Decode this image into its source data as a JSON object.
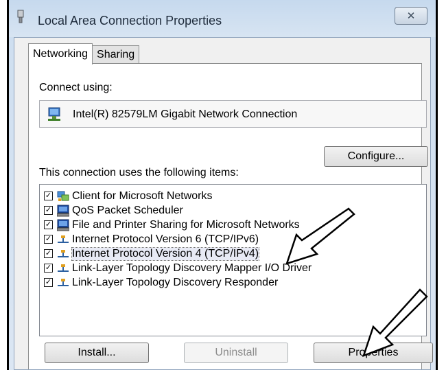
{
  "window": {
    "title": "Local Area Connection Properties",
    "close_glyph": "✕"
  },
  "tabs": [
    {
      "label": "Networking",
      "active": true
    },
    {
      "label": "Sharing",
      "active": false
    }
  ],
  "connect_using": {
    "label": "Connect using:",
    "adapter": "Intel(R) 82579LM Gigabit Network Connection",
    "configure_label": "Configure..."
  },
  "items_section": {
    "label": "This connection uses the following items:",
    "items": [
      {
        "label": "Client for Microsoft Networks",
        "checked": true,
        "icon": "network-client-icon"
      },
      {
        "label": "QoS Packet Scheduler",
        "checked": true,
        "icon": "network-service-icon"
      },
      {
        "label": "File and Printer Sharing for Microsoft Networks",
        "checked": true,
        "icon": "network-service-icon"
      },
      {
        "label": "Internet Protocol Version 6 (TCP/IPv6)",
        "checked": true,
        "icon": "network-protocol-icon"
      },
      {
        "label": "Internet Protocol Version 4 (TCP/IPv4)",
        "checked": true,
        "icon": "network-protocol-icon",
        "selected": true
      },
      {
        "label": "Link-Layer Topology Discovery Mapper I/O Driver",
        "checked": true,
        "icon": "network-protocol-icon"
      },
      {
        "label": "Link-Layer Topology Discovery Responder",
        "checked": true,
        "icon": "network-protocol-icon"
      }
    ],
    "check_glyph": "✓"
  },
  "buttons": {
    "install": "Install...",
    "uninstall": "Uninstall",
    "properties": "Properties"
  }
}
